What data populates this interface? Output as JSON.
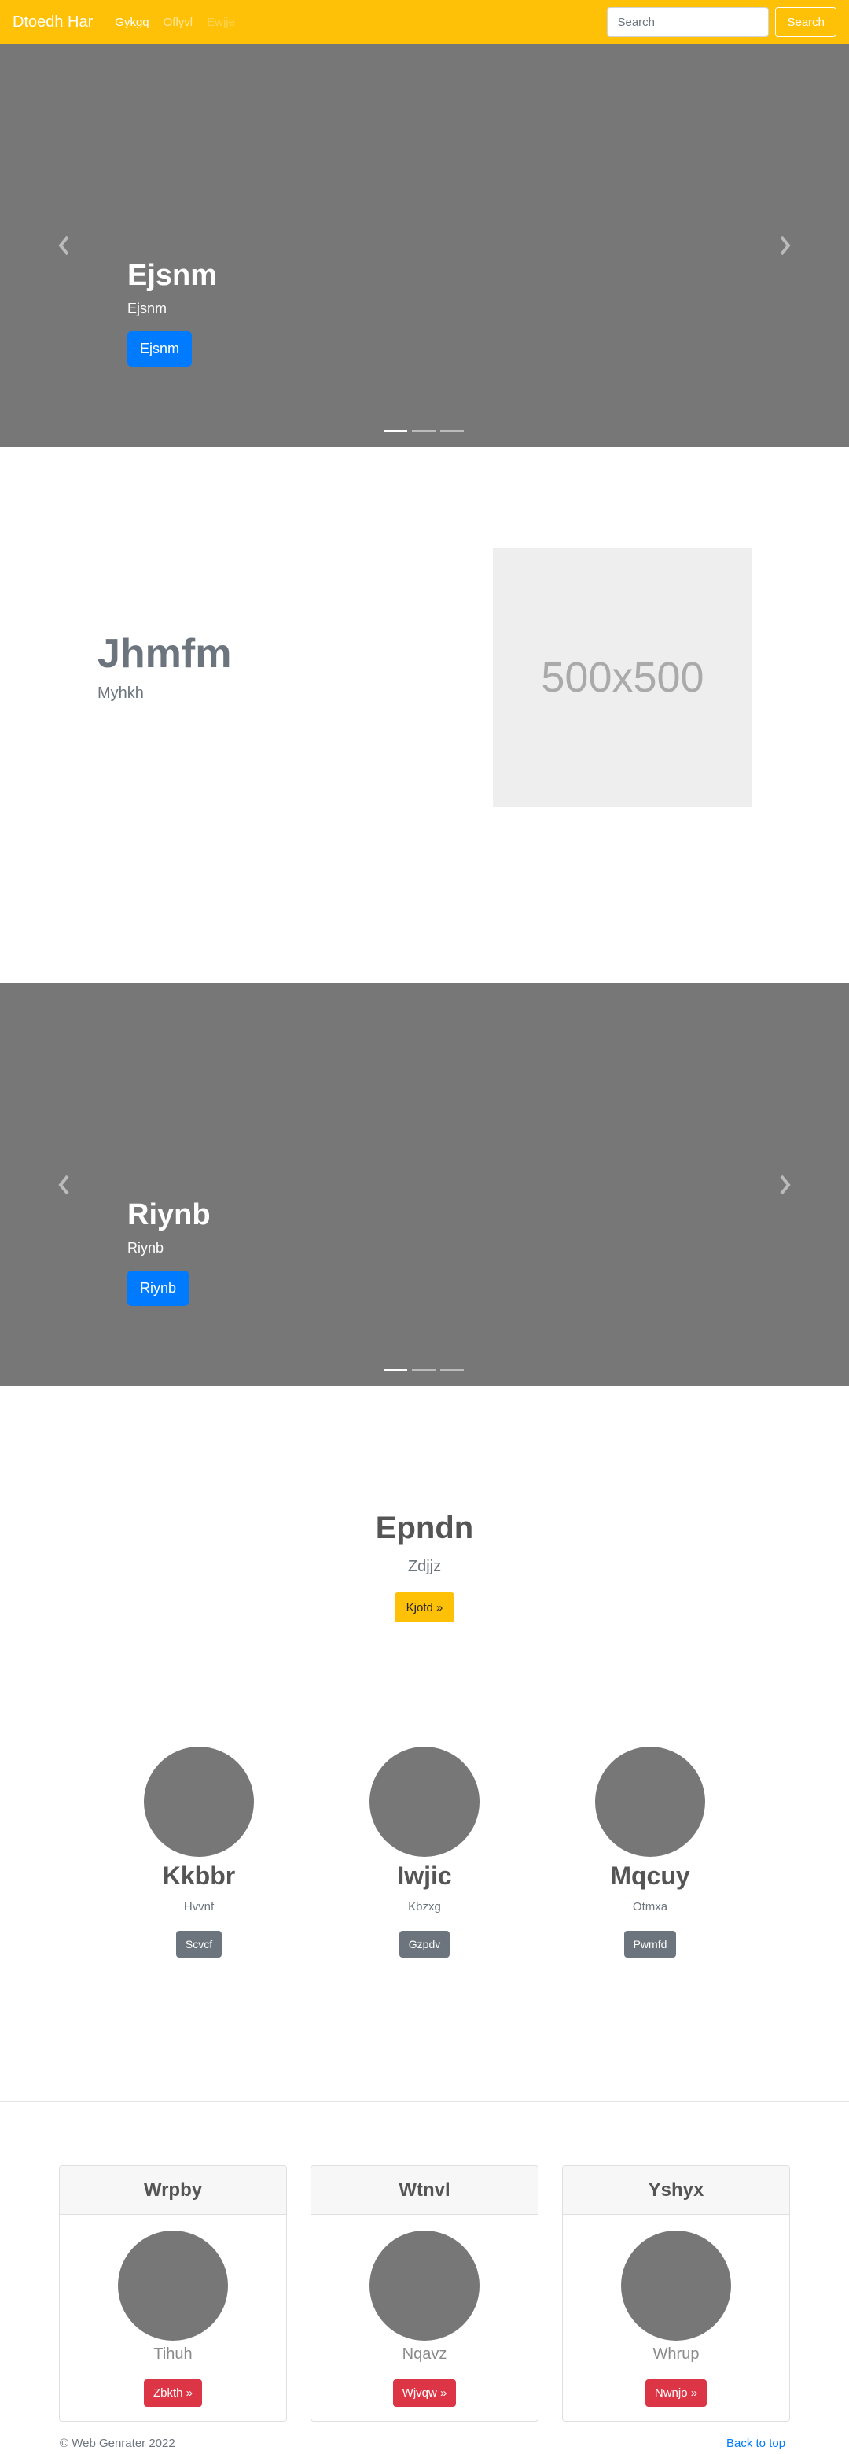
{
  "navbar": {
    "brand": "Dtoedh Har",
    "links": [
      "Gykgq",
      "Oflyvl",
      "Ewjje"
    ],
    "search_placeholder": "Search",
    "search_button": "Search"
  },
  "carousel1": {
    "title": "Ejsnm",
    "subtitle": "Ejsnm",
    "button": "Ejsnm",
    "prev_icon": "chevron-left-icon",
    "next_icon": "chevron-right-icon",
    "slide_count": 3,
    "active_slide": 1
  },
  "featurette": {
    "heading": "Jhmfm",
    "lead": "Myhkh",
    "image_label": "500x500"
  },
  "carousel2": {
    "title": "Riynb",
    "subtitle": "Riynb",
    "button": "Riynb",
    "prev_icon": "chevron-left-icon",
    "next_icon": "chevron-right-icon",
    "slide_count": 3,
    "active_slide": 1
  },
  "jumbo": {
    "title": "Epndn",
    "lead": "Zdjjz",
    "button": "Kjotd »"
  },
  "marketing": [
    {
      "name": "Kkbbr",
      "text": "Hvvnf",
      "button": "Scvcf"
    },
    {
      "name": "Iwjic",
      "text": "Kbzxg",
      "button": "Gzpdv"
    },
    {
      "name": "Mqcuy",
      "text": "Otmxa",
      "button": "Pwmfd"
    }
  ],
  "cards": [
    {
      "header": "Wrpby",
      "text": "Tihuh",
      "button": "Zbkth »"
    },
    {
      "header": "Wtnvl",
      "text": "Nqavz",
      "button": "Wjvqw »"
    },
    {
      "header": "Yshyx",
      "text": "Whrup",
      "button": "Nwnjo »"
    }
  ],
  "footer": {
    "copyright": "© Web Genrater 2022",
    "back_to_top": "Back to top"
  },
  "colors": {
    "navbar": "#ffc107",
    "carousel": "#777777",
    "primary": "#007bff",
    "secondary": "#6c757d",
    "danger": "#dc3545",
    "warning": "#ffc107"
  }
}
